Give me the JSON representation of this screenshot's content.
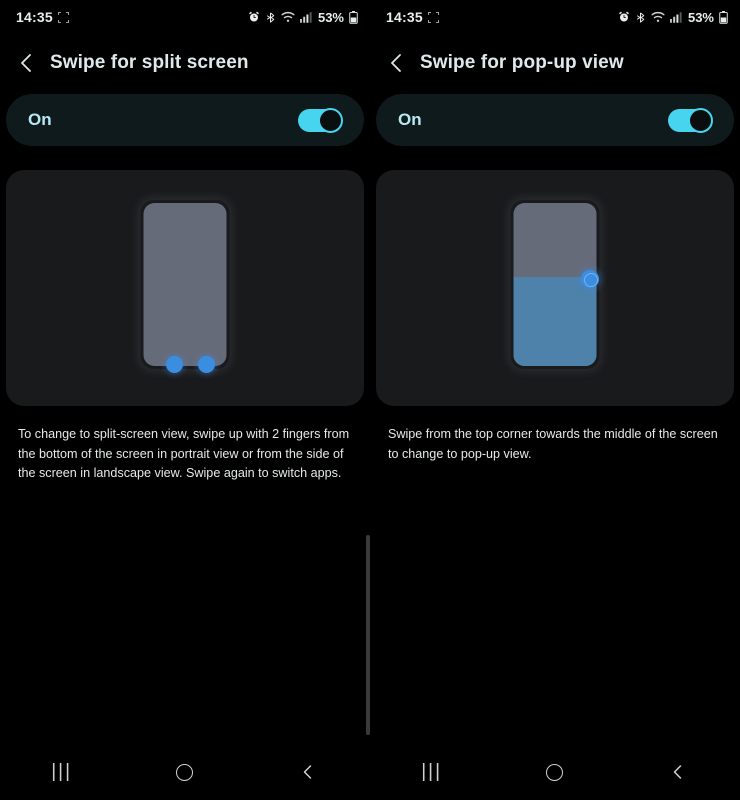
{
  "panels": [
    {
      "status": {
        "time": "14:35",
        "capture_icon": "screenshot-capture-icon",
        "alarm_icon": "alarm-clock-icon",
        "bluetooth_icon": "bluetooth-icon",
        "wifi_icon": "wifi-icon",
        "signal_icon": "cellular-signal-icon",
        "battery_percent": "53%",
        "battery_icon": "battery-icon"
      },
      "title": "Swipe for split screen",
      "back_icon": "back-chevron-icon",
      "toggle": {
        "label": "On",
        "state": "on",
        "accent": "#46d4ef"
      },
      "illustration": {
        "name": "split-screen-illustration",
        "phone_color": "#666b7a",
        "dot_color": "#3b8de0",
        "dots": 2
      },
      "description": "To change to split-screen view, swipe up with 2 fingers from the bottom of the screen in portrait view or from the side of the screen in landscape view. Swipe again to switch apps.",
      "nav": {
        "recents": "|||",
        "home": "home-circle-icon",
        "back": "back-chevron-icon"
      }
    },
    {
      "status": {
        "time": "14:35",
        "capture_icon": "screenshot-capture-icon",
        "alarm_icon": "alarm-clock-icon",
        "bluetooth_icon": "bluetooth-icon",
        "wifi_icon": "wifi-icon",
        "signal_icon": "cellular-signal-icon",
        "battery_percent": "53%",
        "battery_icon": "battery-icon"
      },
      "title": "Swipe for pop-up view",
      "back_icon": "back-chevron-icon",
      "toggle": {
        "label": "On",
        "state": "on",
        "accent": "#46d4ef"
      },
      "illustration": {
        "name": "pop-up-view-illustration",
        "phone_color": "#666b7a",
        "fill_color": "#4e82ab",
        "dot_color": "#3b8de0",
        "dots": 1
      },
      "description": "Swipe from the top corner towards the middle of the screen to change to pop-up view.",
      "nav": {
        "recents": "|||",
        "home": "home-circle-icon",
        "back": "back-chevron-icon"
      }
    }
  ],
  "divider": {
    "name": "panel-divider",
    "color": "#3a3a3e"
  }
}
